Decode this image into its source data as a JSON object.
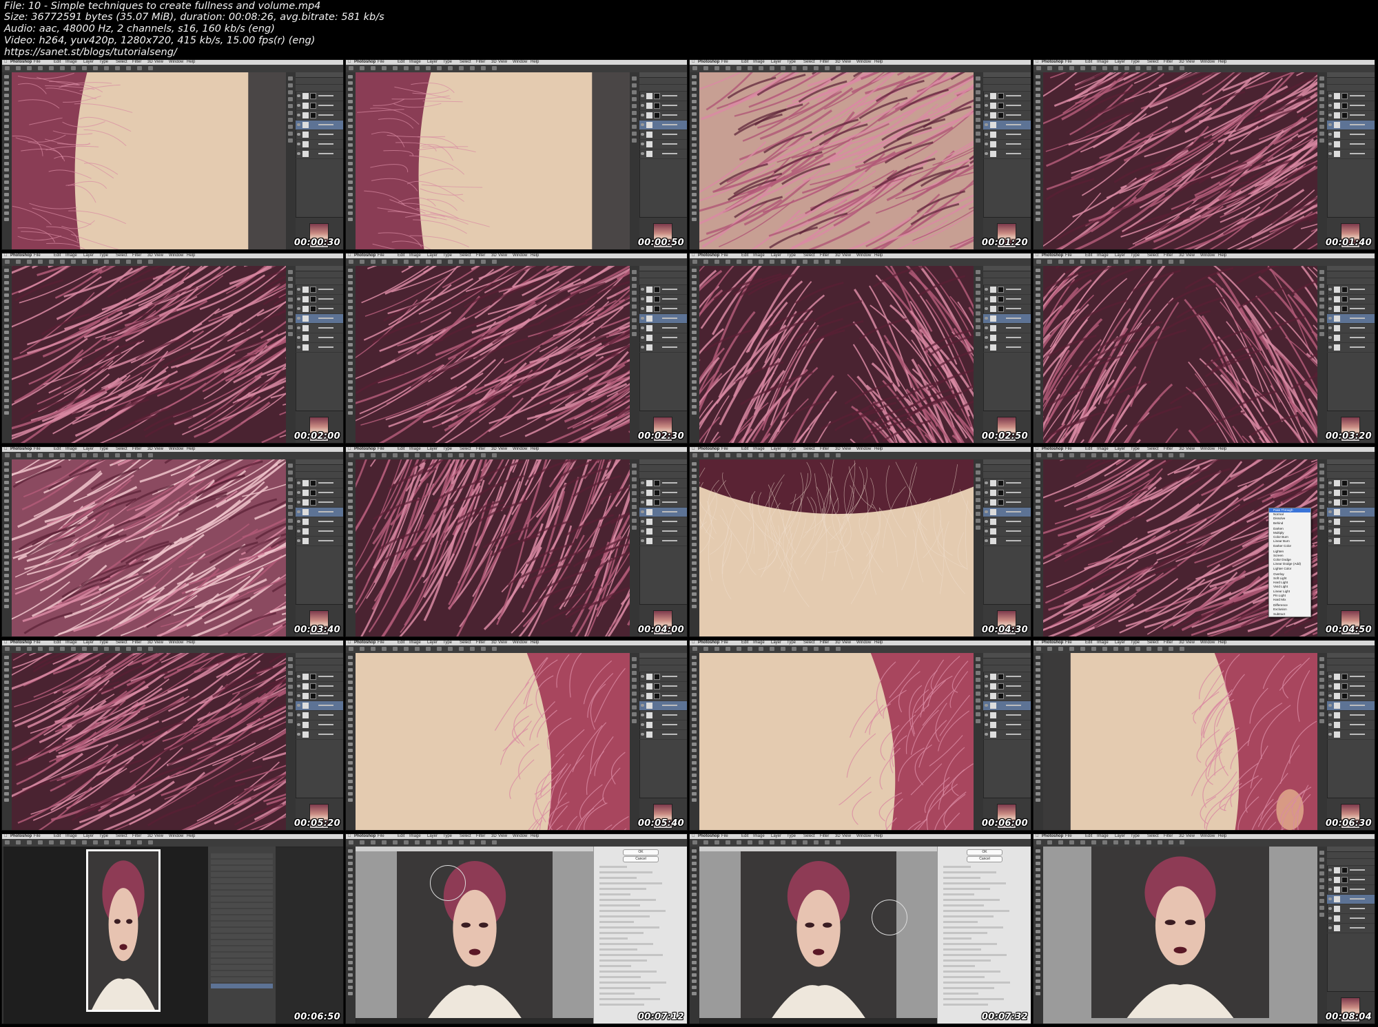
{
  "header": {
    "file_line": "File: 10 - Simple techniques to create fullness and volume.mp4",
    "size_line": "Size: 36772591 bytes (35.07 MiB), duration: 00:08:26, avg.bitrate: 581 kb/s",
    "audio_line": "Audio: aac, 48000 Hz, 2 channels, s16, 160 kb/s (eng)",
    "video_line": "Video: h264, yuv420p, 1280x720, 415 kb/s, 15.00 fps(r) (eng)",
    "url_line": "https://sanet.st/blogs/tutorialseng/"
  },
  "menubar": {
    "app": "Photoshop",
    "items": [
      "File",
      "Edit",
      "Image",
      "Layer",
      "Type",
      "Select",
      "Filter",
      "3D",
      "View",
      "Window",
      "Help"
    ]
  },
  "thumbnails": [
    {
      "time": "00:00:30",
      "scene": "skin-left"
    },
    {
      "time": "00:00:50",
      "scene": "skin-left"
    },
    {
      "time": "00:01:20",
      "scene": "hair-edge"
    },
    {
      "time": "00:01:40",
      "scene": "hair-left"
    },
    {
      "time": "00:02:00",
      "scene": "hair"
    },
    {
      "time": "00:02:30",
      "scene": "hair"
    },
    {
      "time": "00:02:50",
      "scene": "hair-part"
    },
    {
      "time": "00:03:20",
      "scene": "hair-part"
    },
    {
      "time": "00:03:40",
      "scene": "hair-light"
    },
    {
      "time": "00:04:00",
      "scene": "hair-dark"
    },
    {
      "time": "00:04:30",
      "scene": "hairline"
    },
    {
      "time": "00:04:50",
      "scene": "hair-menu"
    },
    {
      "time": "00:05:20",
      "scene": "hair"
    },
    {
      "time": "00:05:40",
      "scene": "skin-right"
    },
    {
      "time": "00:06:00",
      "scene": "skin-right"
    },
    {
      "time": "00:06:30",
      "scene": "skin-ear"
    },
    {
      "time": "00:06:50",
      "scene": "history"
    },
    {
      "time": "00:07:12",
      "scene": "liquify"
    },
    {
      "time": "00:07:32",
      "scene": "liquify"
    },
    {
      "time": "00:08:04",
      "scene": "portrait"
    }
  ],
  "blend_menu": {
    "items": [
      "Pass Through",
      "Normal",
      "Dissolve",
      "Behind",
      "Darken",
      "Multiply",
      "Color Burn",
      "Linear Burn",
      "Darker Color",
      "Lighten",
      "Screen",
      "Color Dodge",
      "Linear Dodge (Add)",
      "Lighter Color",
      "Overlay",
      "Soft Light",
      "Hard Light",
      "Vivid Light",
      "Linear Light",
      "Pin Light",
      "Hard Mix",
      "Difference",
      "Exclusion",
      "Subtract"
    ]
  },
  "liquify": {
    "ok": "OK",
    "cancel": "Cancel"
  },
  "colors": {
    "hair_dark": "#5a1f34",
    "hair_light": "#d98aa3",
    "skin": "#e4cbb0",
    "background": "#000000",
    "timestamp": "#ffffff",
    "selected_layer": "#5d7395"
  }
}
